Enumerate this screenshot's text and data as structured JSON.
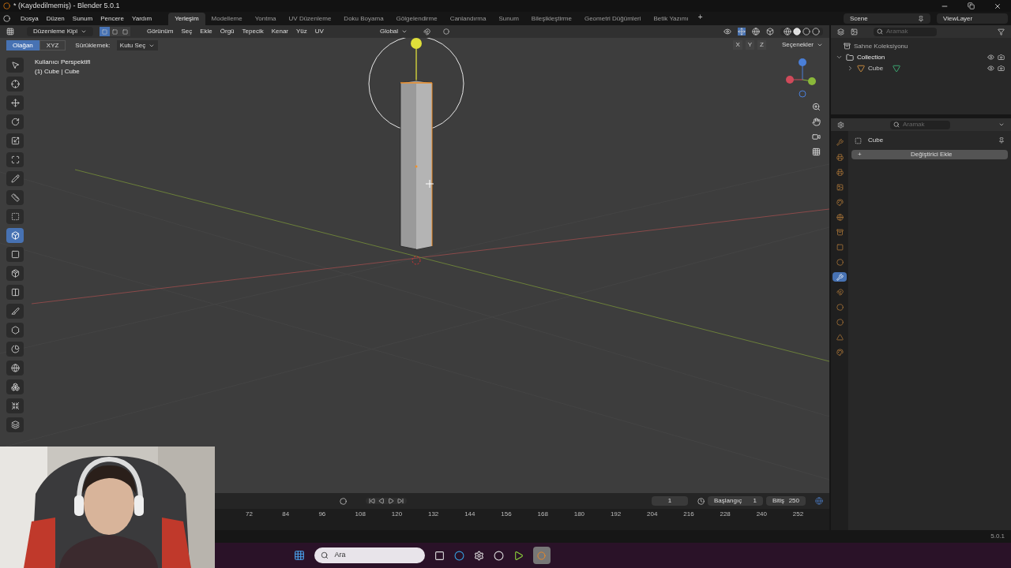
{
  "window": {
    "title": "* (Kaydedilmemiş) - Blender 5.0.1"
  },
  "menu": [
    "Dosya",
    "Düzen",
    "Sunum",
    "Pencere",
    "Yardım"
  ],
  "workspaces": [
    {
      "label": "Yerleşim",
      "selected": true
    },
    {
      "label": "Modelleme",
      "selected": false
    },
    {
      "label": "Yontma",
      "selected": false
    },
    {
      "label": "UV Düzenleme",
      "selected": false
    },
    {
      "label": "Doku Boyama",
      "selected": false
    },
    {
      "label": "Gölgelendirme",
      "selected": false
    },
    {
      "label": "Canlandırma",
      "selected": false
    },
    {
      "label": "Sunum",
      "selected": false
    },
    {
      "label": "Bileşikleştirme",
      "selected": false
    },
    {
      "label": "Geometri Düğümleri",
      "selected": false
    },
    {
      "label": "Betik Yazımı",
      "selected": false
    }
  ],
  "add_workspace": "+",
  "scene": {
    "name": "Scene",
    "view_layer": "ViewLayer"
  },
  "viewport_header": {
    "mode": "Düzenleme Kipi",
    "select_modes": [
      {
        "selected": true
      },
      {
        "selected": false
      },
      {
        "selected": false
      }
    ],
    "menus": [
      "Görünüm",
      "Seç",
      "Ekle",
      "Örgü",
      "Tepecik",
      "Kenar",
      "Yüz",
      "UV"
    ],
    "orientation": "Global"
  },
  "tool_settings": {
    "options": [
      {
        "label": "Olağan",
        "selected": true
      },
      {
        "label": "XYZ",
        "selected": false
      }
    ],
    "drag_label": "Sürüklemek:",
    "drag_value": "Kutu Seç",
    "mirror_axes": [
      "X",
      "Y",
      "Z"
    ],
    "options_menu": "Seçenekler"
  },
  "viewport": {
    "view_name": "Kullanıcı Perspektifi",
    "object_info": "(1) Cube | Cube"
  },
  "tools": [
    {
      "selected": false
    },
    {
      "selected": false
    },
    {
      "selected": false
    },
    {
      "selected": false
    },
    {
      "selected": false
    },
    {
      "selected": false
    },
    {
      "selected": false
    },
    {
      "selected": false
    },
    {
      "selected": false
    },
    {
      "selected": true
    },
    {
      "selected": false
    },
    {
      "selected": false
    },
    {
      "selected": false
    },
    {
      "selected": false
    },
    {
      "selected": false
    },
    {
      "selected": false
    },
    {
      "selected": false
    },
    {
      "selected": false
    },
    {
      "selected": false
    },
    {
      "selected": false
    }
  ],
  "outliner": {
    "search_placeholder": "Aramak",
    "root": "Sahne Koleksiyonu",
    "tree": [
      {
        "label": "Collection",
        "expanded": true,
        "children": [
          {
            "label": "Cube",
            "expanded": false
          }
        ]
      }
    ]
  },
  "properties": {
    "search_placeholder": "Aramak",
    "object": "Cube",
    "add_modifier_icon": "+",
    "add_modifier": "Değiştirici Ekle",
    "tabs": [
      {
        "selected": false
      },
      {
        "selected": false
      },
      {
        "selected": false
      },
      {
        "selected": false
      },
      {
        "selected": false
      },
      {
        "selected": false
      },
      {
        "selected": false
      },
      {
        "selected": false
      },
      {
        "selected": false
      },
      {
        "selected": true
      },
      {
        "selected": false
      },
      {
        "selected": false
      },
      {
        "selected": false
      },
      {
        "selected": false
      },
      {
        "selected": false
      }
    ]
  },
  "timeline": {
    "current_frame": "1",
    "start_label": "Başlangıç",
    "start": "1",
    "end_label": "Bitiş",
    "end": "250",
    "ruler": [
      "72",
      "84",
      "96",
      "108",
      "120",
      "132",
      "144",
      "156",
      "168",
      "180",
      "192",
      "204",
      "216",
      "228",
      "240",
      "252"
    ]
  },
  "status_bar": {
    "version": "5.0.1"
  },
  "taskbar": {
    "search_placeholder": "Ara"
  }
}
